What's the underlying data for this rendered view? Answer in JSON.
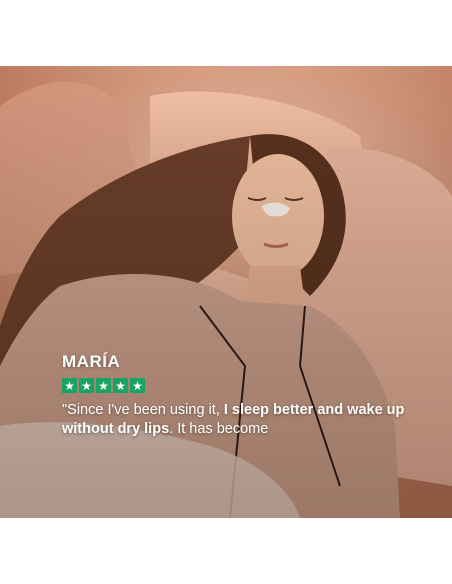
{
  "review": {
    "name": "MARÍA",
    "rating": 5,
    "star_color": "#1aa364",
    "quote_part1": "\"Since I've been using it, ",
    "quote_bold": "I sleep better and wake up without dry lips",
    "quote_part2": ". It has become"
  }
}
